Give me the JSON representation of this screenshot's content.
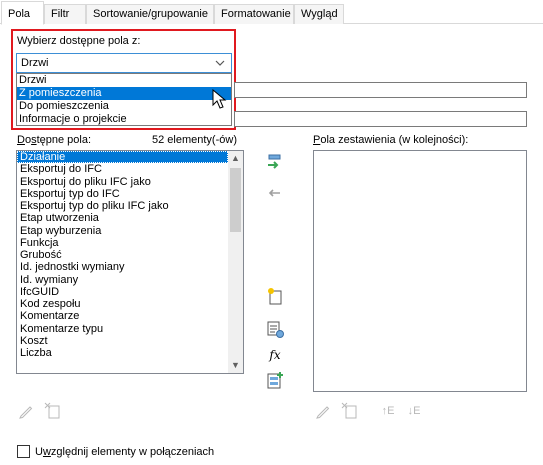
{
  "tabs": [
    {
      "label": "Pola"
    },
    {
      "label": "Filtr"
    },
    {
      "label": "Sortowanie/grupowanie"
    },
    {
      "label": "Formatowanie"
    },
    {
      "label": "Wygląd"
    }
  ],
  "select_from": {
    "label": "Wybierz dostępne pola z:",
    "value": "Drzwi",
    "options": [
      "Drzwi",
      "Z pomieszczenia",
      "Do pomieszczenia",
      "Informacje o projekcie"
    ],
    "highlighted_index": 1
  },
  "available_fields": {
    "label": "Dostępne pola:",
    "count_text": "52 elementy(-ów)",
    "selected_index": 0,
    "items": [
      "Działanie",
      "Eksportuj do IFC",
      "Eksportuj do pliku IFC jako",
      "Eksportuj typ do IFC",
      "Eksportuj typ do pliku IFC jako",
      "Etap utworzenia",
      "Etap wyburzenia",
      "Funkcja",
      "Grubość",
      "Id. jednostki wymiany",
      "Id. wymiany",
      "IfcGUID",
      "Kod zespołu",
      "Komentarze",
      "Komentarze typu",
      "Koszt",
      "Liczba"
    ]
  },
  "schedule_fields": {
    "label": "Pola zestawienia (w kolejności):",
    "items": []
  },
  "linked_checkbox": {
    "label": "Uwzględnij elementy w połączeniach",
    "checked": false
  },
  "icons": {
    "add": "arrow-right-icon",
    "remove": "arrow-left-icon",
    "new_param": "new-parameter-icon",
    "calc": "calculated-value-icon",
    "fx": "formula-icon",
    "combine": "combine-parameters-icon",
    "edit": "pencil-icon",
    "delete": "delete-parameter-icon",
    "move_up": "move-up-icon",
    "move_down": "move-down-icon"
  },
  "colors": {
    "accent": "#0078d7",
    "highlight_border": "#e0191f",
    "add_arrow": "#3aa655"
  }
}
